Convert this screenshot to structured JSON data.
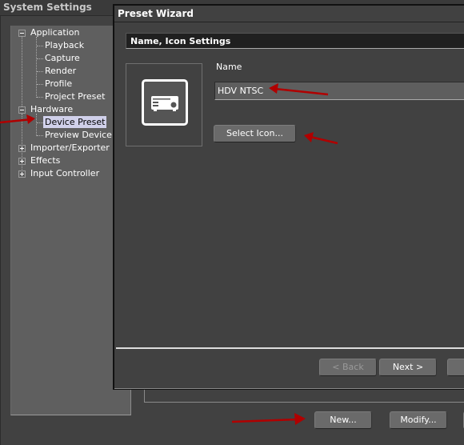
{
  "system_settings": {
    "title": "System Settings",
    "tree": [
      {
        "label": "Application",
        "level": 0,
        "expander": "minus"
      },
      {
        "label": "Playback",
        "level": 1
      },
      {
        "label": "Capture",
        "level": 1
      },
      {
        "label": "Render",
        "level": 1
      },
      {
        "label": "Profile",
        "level": 1
      },
      {
        "label": "Project Preset",
        "level": 1
      },
      {
        "label": "Hardware",
        "level": 0,
        "expander": "minus"
      },
      {
        "label": "Device Preset",
        "level": 1,
        "selected": true
      },
      {
        "label": "Preview Device",
        "level": 1
      },
      {
        "label": "Importer/Exporter",
        "level": 0,
        "expander": "plus"
      },
      {
        "label": "Effects",
        "level": 0,
        "expander": "plus"
      },
      {
        "label": "Input Controller",
        "level": 0,
        "expander": "plus"
      }
    ],
    "buttons": {
      "new": "New...",
      "modify": "Modify..."
    }
  },
  "wizard": {
    "title": "Preset Wizard",
    "section_header": "Name, Icon Settings",
    "icon": "projector-device-icon",
    "name_label": "Name",
    "name_value": "HDV NTSC",
    "select_icon_label": "Select Icon...",
    "buttons": {
      "back": "< Back",
      "next": "Next >"
    }
  },
  "annotations": {
    "arrow_color": "#b00000"
  }
}
